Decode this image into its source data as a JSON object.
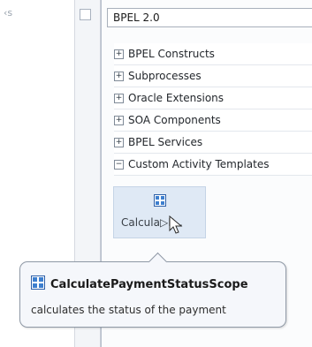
{
  "left_pane": {
    "fragment_text": "‹s"
  },
  "palette": {
    "selected": "BPEL 2.0",
    "categories": [
      {
        "label": "BPEL Constructs",
        "expanded": false,
        "toggle": "+"
      },
      {
        "label": "Subprocesses",
        "expanded": false,
        "toggle": "+"
      },
      {
        "label": "Oracle Extensions",
        "expanded": false,
        "toggle": "+"
      },
      {
        "label": "SOA Components",
        "expanded": false,
        "toggle": "+"
      },
      {
        "label": "BPEL Services",
        "expanded": false,
        "toggle": "+"
      },
      {
        "label": "Custom Activity Templates",
        "expanded": true,
        "toggle": "−"
      }
    ],
    "item": {
      "label": "Calcula▷P...",
      "icon": "scope-icon"
    }
  },
  "tooltip": {
    "title": "CalculatePaymentStatusScope",
    "description": "calculates the status of the payment",
    "icon": "scope-icon"
  },
  "colors": {
    "hover_bg": "#dfe9f5",
    "tooltip_bg": "#f5f7fb",
    "border": "#8f99a6"
  }
}
